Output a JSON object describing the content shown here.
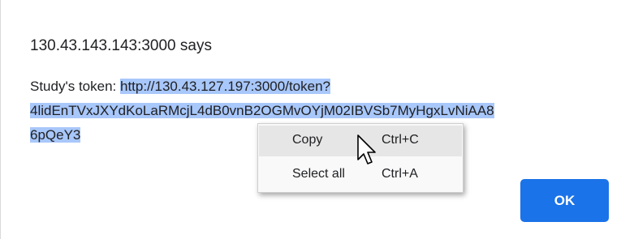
{
  "dialog": {
    "title": "130.43.143.143:3000 says",
    "message_prefix": "Study's token: ",
    "message_selected_line1": "http://130.43.127.197:3000/token?",
    "message_selected_line2": "4lidEnTVxJXYdKoLaRMcjL4dB0vnB2OGMvOYjM02IBVSb7MyHgxLvNiAA8",
    "message_selected_line3": "6pQeY3",
    "ok_label": "OK"
  },
  "context_menu": {
    "items": [
      {
        "label": "Copy",
        "shortcut": "Ctrl+C",
        "highlighted": true
      },
      {
        "label": "Select all",
        "shortcut": "Ctrl+A",
        "highlighted": false
      }
    ]
  },
  "colors": {
    "selection": "#a8c7fa",
    "ok_button": "#1a73e8",
    "menu_hover": "#e6e6e6"
  }
}
